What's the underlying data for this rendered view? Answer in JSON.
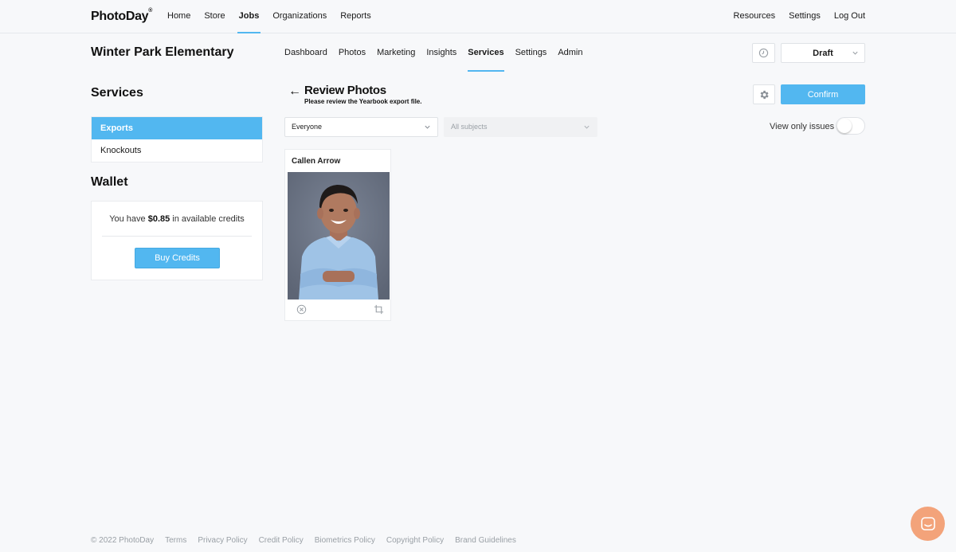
{
  "topnav": {
    "logo": "PhotoDay",
    "logo_tm": "®",
    "left_items": [
      {
        "label": "Home",
        "active": false
      },
      {
        "label": "Store",
        "active": false
      },
      {
        "label": "Jobs",
        "active": true
      },
      {
        "label": "Organizations",
        "active": false
      },
      {
        "label": "Reports",
        "active": false
      }
    ],
    "right_items": [
      "Resources",
      "Settings",
      "Log Out"
    ]
  },
  "job": {
    "title": "Winter Park Elementary",
    "tabs": [
      {
        "label": "Dashboard",
        "active": false
      },
      {
        "label": "Photos",
        "active": false
      },
      {
        "label": "Marketing",
        "active": false
      },
      {
        "label": "Insights",
        "active": false
      },
      {
        "label": "Services",
        "active": true
      },
      {
        "label": "Settings",
        "active": false
      },
      {
        "label": "Admin",
        "active": false
      }
    ],
    "status": "Draft"
  },
  "sidebar": {
    "services_heading": "Services",
    "services_items": [
      {
        "label": "Exports",
        "active": true
      },
      {
        "label": "Knockouts",
        "active": false
      }
    ],
    "wallet_heading": "Wallet",
    "wallet_text_before": "You have ",
    "wallet_amount": "$0.85",
    "wallet_text_after": " in available credits",
    "buy_credits_label": "Buy Credits"
  },
  "main": {
    "back_arrow": "←",
    "title": "Review Photos",
    "subtitle": "Please review the Yearbook export file.",
    "confirm_label": "Confirm",
    "filter_people": "Everyone",
    "filter_subjects": "All subjects",
    "view_issues_label": "View only issues",
    "view_issues_on": false,
    "photos": [
      {
        "name": "Callen Arrow"
      }
    ]
  },
  "footer": {
    "copyright": "© 2022 PhotoDay",
    "links": [
      "Terms",
      "Privacy Policy",
      "Credit Policy",
      "Biometrics Policy",
      "Copyright Policy",
      "Brand Guidelines"
    ]
  },
  "colors": {
    "accent": "#52b7f0",
    "background": "#f7f8fa",
    "chat": "#f3a37a"
  }
}
